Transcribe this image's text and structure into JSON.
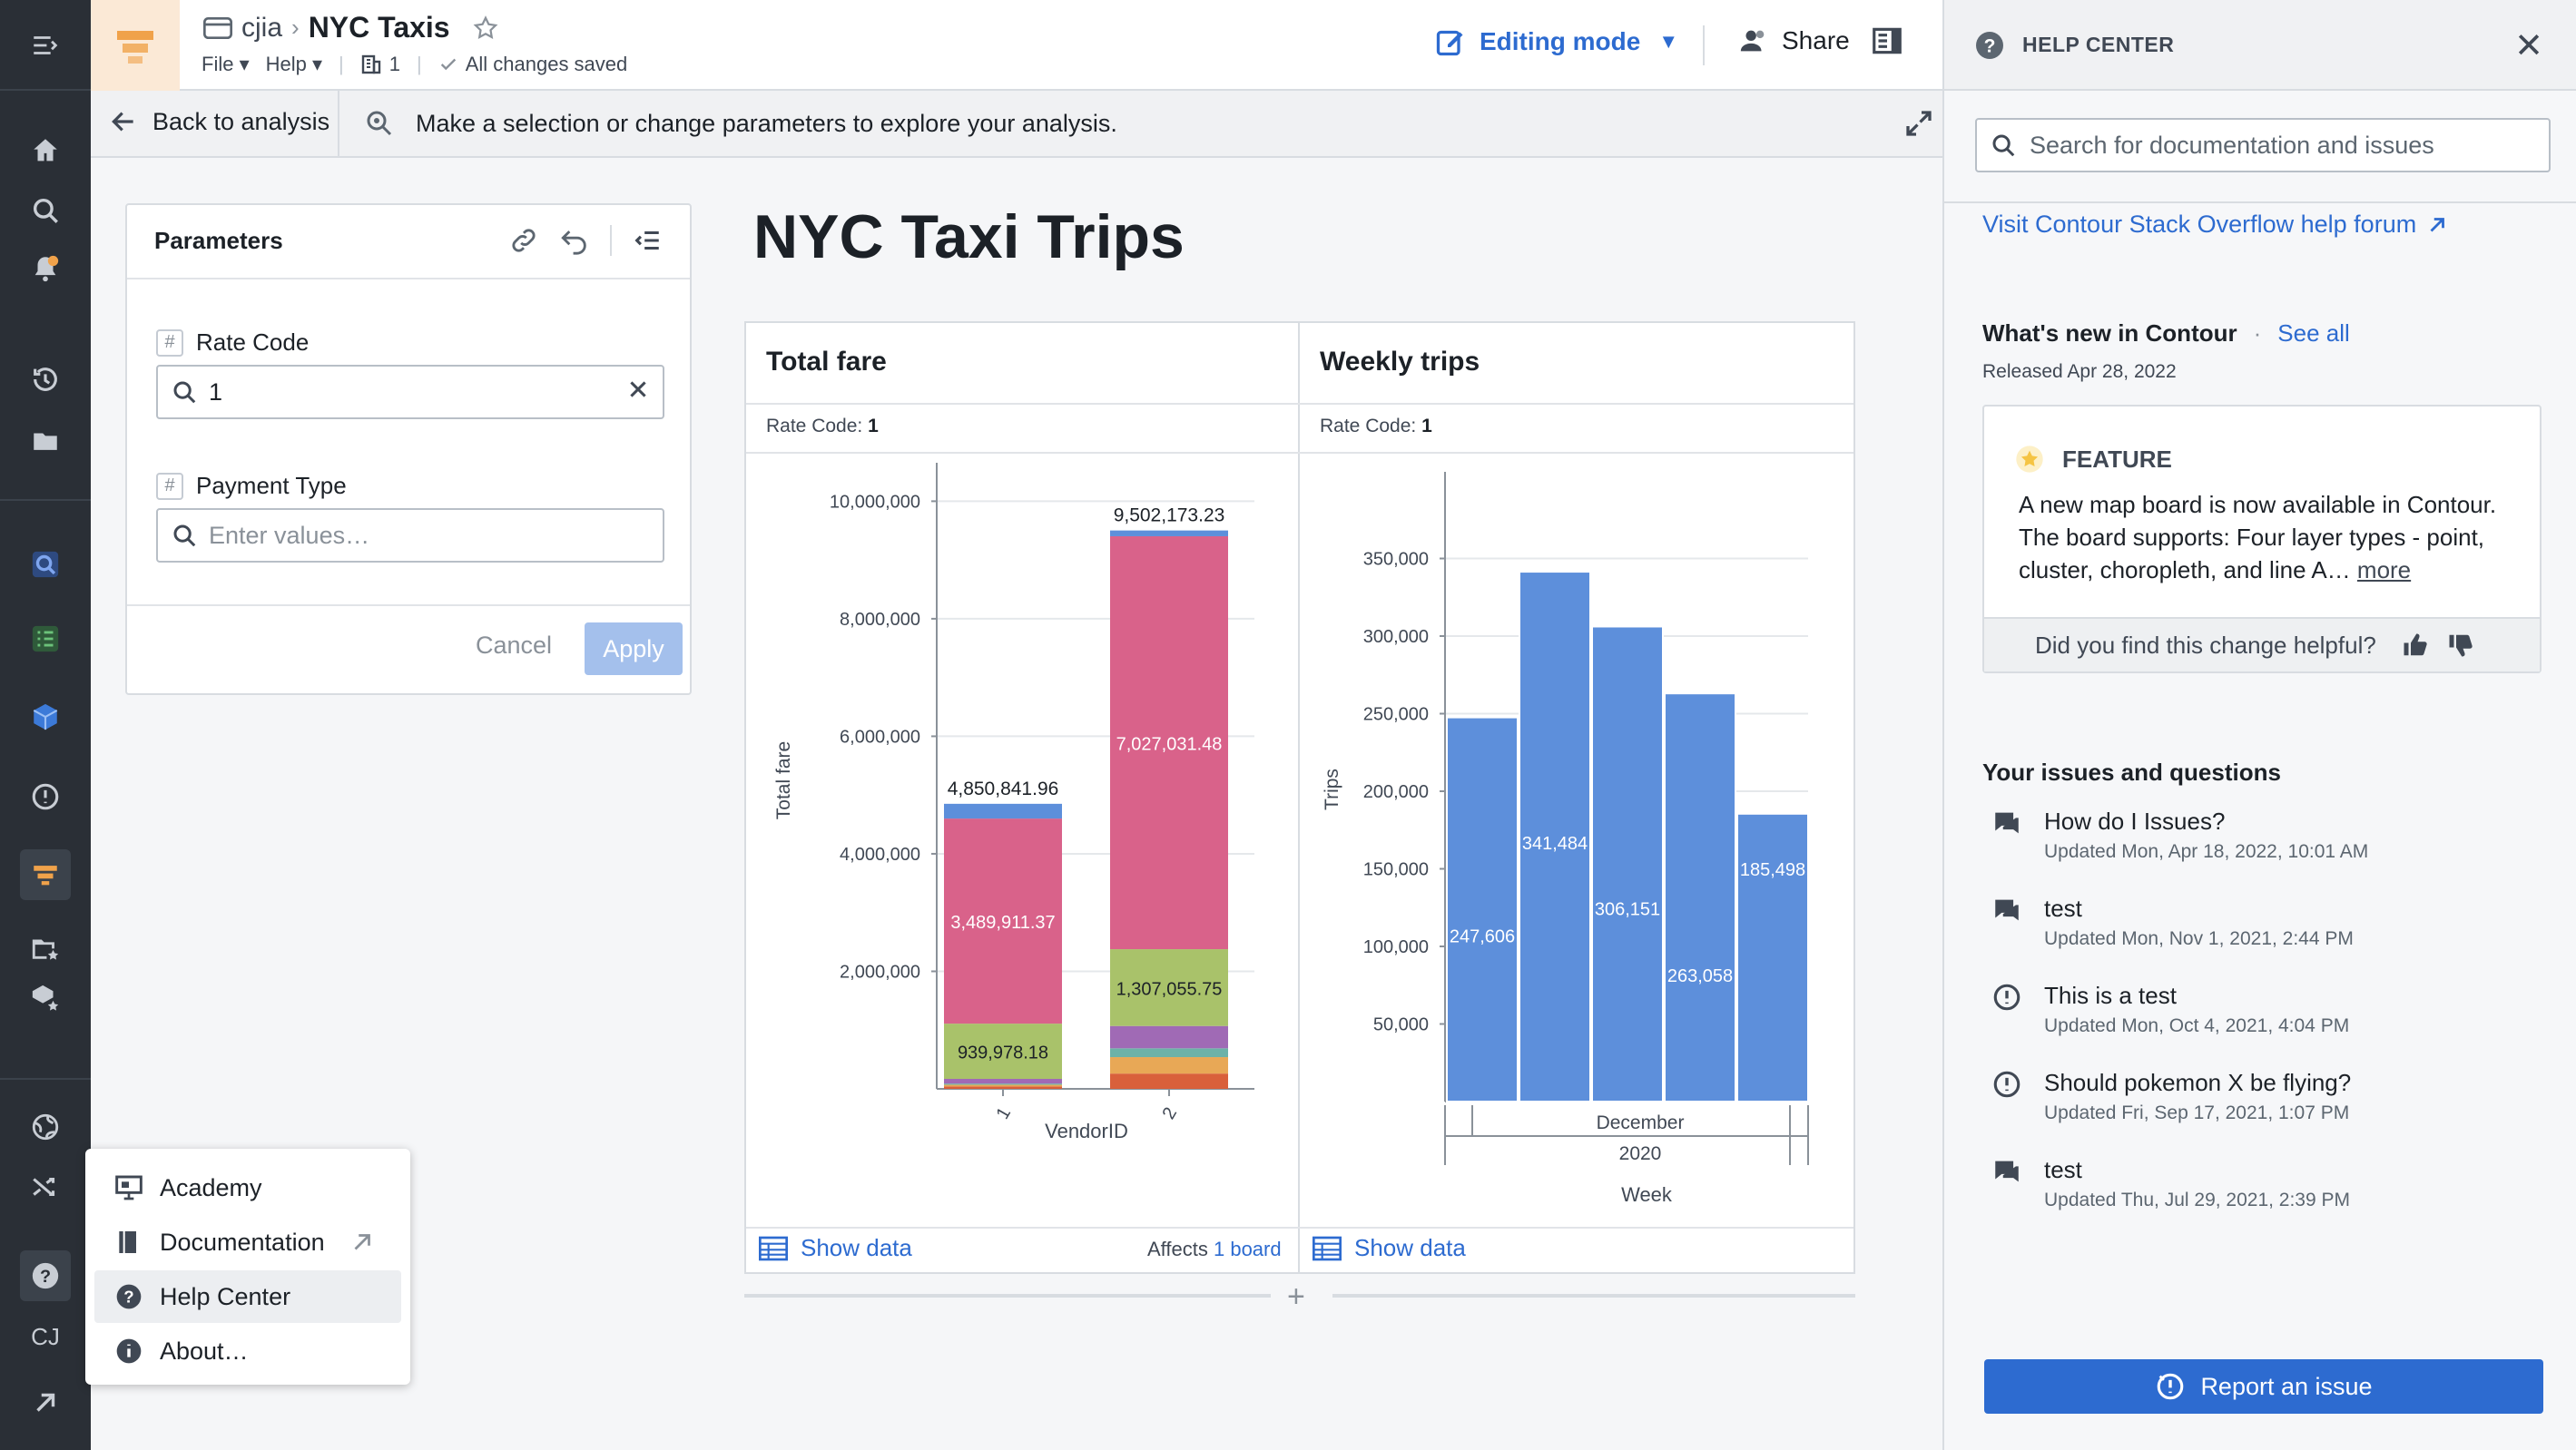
{
  "rail": {
    "icons": [
      "menu-expand-icon",
      "home-icon",
      "search-icon",
      "notifications-icon",
      "history-icon",
      "folder-icon",
      "object-explorer-icon",
      "checklist-icon",
      "cube-icon",
      "alert-icon",
      "contour-icon",
      "folder-star-icon",
      "cube-star-icon",
      "globe-icon",
      "shuffle-icon",
      "help-icon"
    ],
    "user_initials": "CJ"
  },
  "header": {
    "parent": "cjia",
    "title": "NYC Taxis",
    "menu_file": "File",
    "menu_help": "Help",
    "branch_count": "1",
    "save_status": "All changes saved",
    "editing_label": "Editing mode",
    "share_label": "Share"
  },
  "subbar": {
    "back_label": "Back to analysis",
    "hint": "Make a selection or change parameters to explore your analysis."
  },
  "parameters": {
    "title": "Parameters",
    "p1_label": "Rate Code",
    "p1_value": "1",
    "p2_label": "Payment Type",
    "p2_placeholder": "Enter values…",
    "cancel": "Cancel",
    "apply": "Apply"
  },
  "dashboard_title": "NYC Taxi Trips",
  "charts": {
    "left": {
      "title": "Total fare",
      "filter_label": "Rate Code:",
      "filter_value": "1",
      "show_data": "Show data",
      "affects_prefix": "Affects",
      "affects_link": "1 board"
    },
    "right": {
      "title": "Weekly trips",
      "filter_label": "Rate Code:",
      "filter_value": "1",
      "show_data": "Show data"
    }
  },
  "chart_data": [
    {
      "type": "bar",
      "stacked": true,
      "title": "Total fare",
      "xlabel": "VendorID",
      "ylabel": "Total fare",
      "categories": [
        "1",
        "2"
      ],
      "ylim": [
        0,
        10500000
      ],
      "yticks": [
        "2,000,000",
        "4,000,000",
        "6,000,000",
        "8,000,000",
        "10,000,000"
      ],
      "totals": [
        "4,850,841.96",
        "9,502,173.23"
      ],
      "series": [
        {
          "color": "#d9603b",
          "values": [
            40000,
            260000
          ]
        },
        {
          "color": "#e8a856",
          "values": [
            30000,
            280000
          ]
        },
        {
          "color": "#6cb2a8",
          "values": [
            20000,
            150000
          ]
        },
        {
          "color": "#a06ab5",
          "values": [
            80000,
            380000
          ]
        },
        {
          "color": "#a9c26a",
          "values": [
            939978.18,
            1307055.75
          ],
          "labels": [
            "939,978.18",
            "1,307,055.75"
          ]
        },
        {
          "color": "#d9628a",
          "values": [
            3489911.37,
            7027031.48
          ],
          "labels": [
            "3,489,911.37",
            "7,027,031.48"
          ]
        },
        {
          "color": "#5d8fdb",
          "values": [
            250952.41,
            98086.0
          ]
        }
      ]
    },
    {
      "type": "bar",
      "title": "Weekly trips",
      "xlabel": "Week",
      "ylabel": "Trips",
      "group_labels": [
        "December",
        "2020"
      ],
      "ylim": [
        0,
        400000
      ],
      "yticks": [
        "50,000",
        "100,000",
        "150,000",
        "200,000",
        "250,000",
        "300,000",
        "350,000"
      ],
      "values": [
        247606,
        341484,
        306151,
        263058,
        185498
      ],
      "labels": [
        "247,606",
        "341,484",
        "306,151",
        "263,058",
        "185,498"
      ],
      "color": "#5d8fdb"
    }
  ],
  "help_center": {
    "title": "HELP CENTER",
    "search_placeholder": "Search for documentation and issues",
    "forum_link": "Visit Contour Stack Overflow help forum",
    "whats_new": "What's new in Contour",
    "see_all": "See all",
    "released": "Released Apr 28, 2022",
    "feature_tag": "FEATURE",
    "feature_text": "A new map board is now available in Contour. The board supports: Four layer types - point, cluster, choropleth, and line A…",
    "feature_more": "more",
    "helpful_q": "Did you find this change helpful?",
    "issues_title": "Your issues and questions",
    "issues": [
      {
        "icon": "chat-icon",
        "title": "How do I Issues?",
        "updated": "Updated Mon, Apr 18, 2022, 10:01 AM"
      },
      {
        "icon": "chat-icon",
        "title": "test",
        "updated": "Updated Mon, Nov 1, 2021, 2:44 PM"
      },
      {
        "icon": "alert-icon",
        "title": "This is a test",
        "updated": "Updated Mon, Oct 4, 2021, 4:04 PM"
      },
      {
        "icon": "alert-icon",
        "title": "Should pokemon X be flying?",
        "updated": "Updated Fri, Sep 17, 2021, 1:07 PM"
      },
      {
        "icon": "chat-icon",
        "title": "test",
        "updated": "Updated Thu, Jul 29, 2021, 2:39 PM"
      }
    ],
    "report_label": "Report an issue"
  },
  "help_menu": {
    "items": [
      "Academy",
      "Documentation",
      "Help Center",
      "About…"
    ]
  }
}
